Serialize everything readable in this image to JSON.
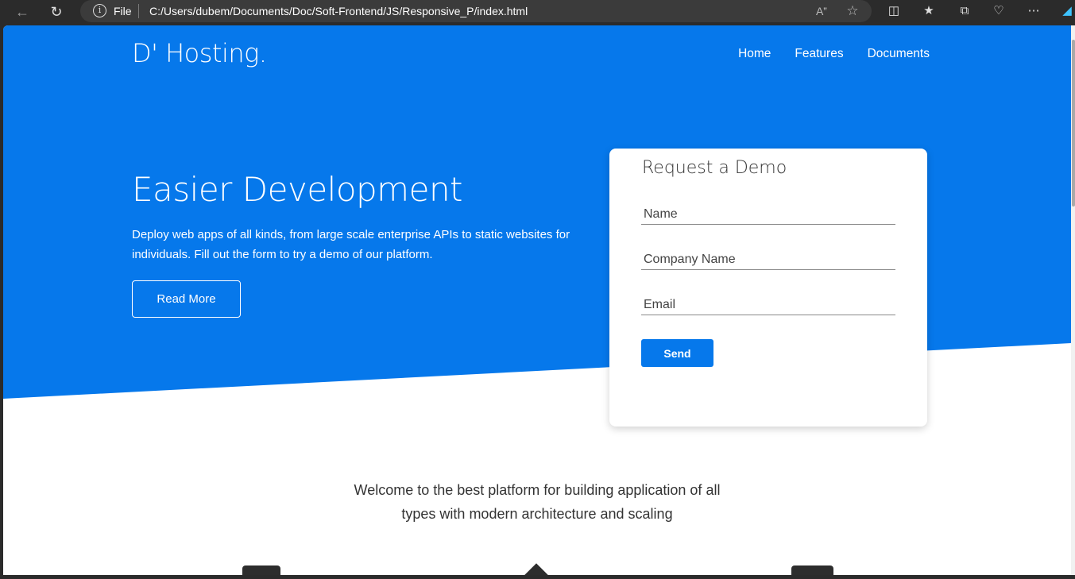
{
  "browser": {
    "back_icon": "arrow-left-icon",
    "reload_icon": "reload-icon",
    "scheme": "File",
    "url": "C:/Users/dubem/Documents/Doc/Soft-Frontend/JS/Responsive_P/index.html"
  },
  "site": {
    "logo": "D' Hosting.",
    "nav": [
      "Home",
      "Features",
      "Documents"
    ]
  },
  "hero": {
    "title": "Easier Development",
    "text": "Deploy web apps of all kinds, from large scale enterprise APIs to static websites for individuals. Fill out the form to try a demo of our platform.",
    "button": "Read More"
  },
  "demo_form": {
    "title": "Request a Demo",
    "name_placeholder": "Name",
    "company_placeholder": "Company Name",
    "email_placeholder": "Email",
    "send_label": "Send"
  },
  "welcome": {
    "line1": "Welcome to the best platform for building application of all",
    "line2": "types with modern architecture and scaling"
  },
  "colors": {
    "brand_blue": "#0678eb",
    "text_dark": "#333333"
  }
}
